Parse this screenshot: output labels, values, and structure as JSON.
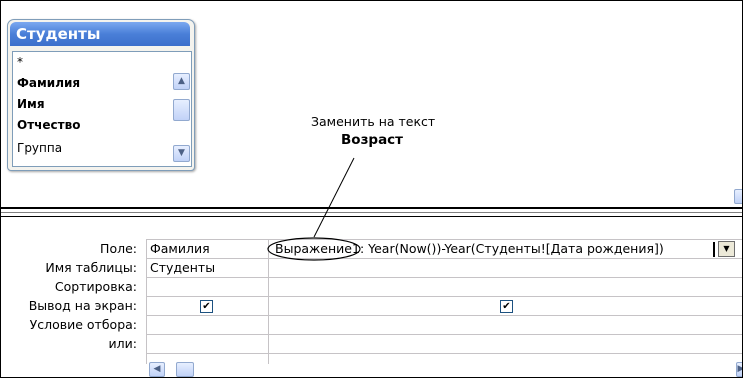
{
  "table_box": {
    "title": "Студенты",
    "fields": [
      {
        "name": "*",
        "bold": false
      },
      {
        "name": "Фамилия",
        "bold": true
      },
      {
        "name": "Имя",
        "bold": true
      },
      {
        "name": "Отчество",
        "bold": true
      },
      {
        "name": "Группа",
        "bold": false
      }
    ]
  },
  "annotation": {
    "line1": "Заменить на текст",
    "line2": "Возраст"
  },
  "grid": {
    "row_labels": [
      "Поле:",
      "Имя таблицы:",
      "Сортировка:",
      "Вывод на экран:",
      "Условие отбора:",
      "или:"
    ],
    "columns": [
      {
        "field": "Фамилия",
        "table": "Студенты",
        "show": true
      },
      {
        "field": "Выражение1: Year(Now())-Year(Студенты![Дата рождения])",
        "table": "",
        "show": true
      }
    ],
    "circled_text": "Выражение1",
    "expression_rest": ": Year(Now())-Year(Студенты![Дата рождения])"
  },
  "icons": {
    "scroll_up": "▲",
    "scroll_down": "▼",
    "scroll_left": "◀",
    "scroll_right": "▶",
    "check": "✔",
    "combo_down": "▼"
  }
}
